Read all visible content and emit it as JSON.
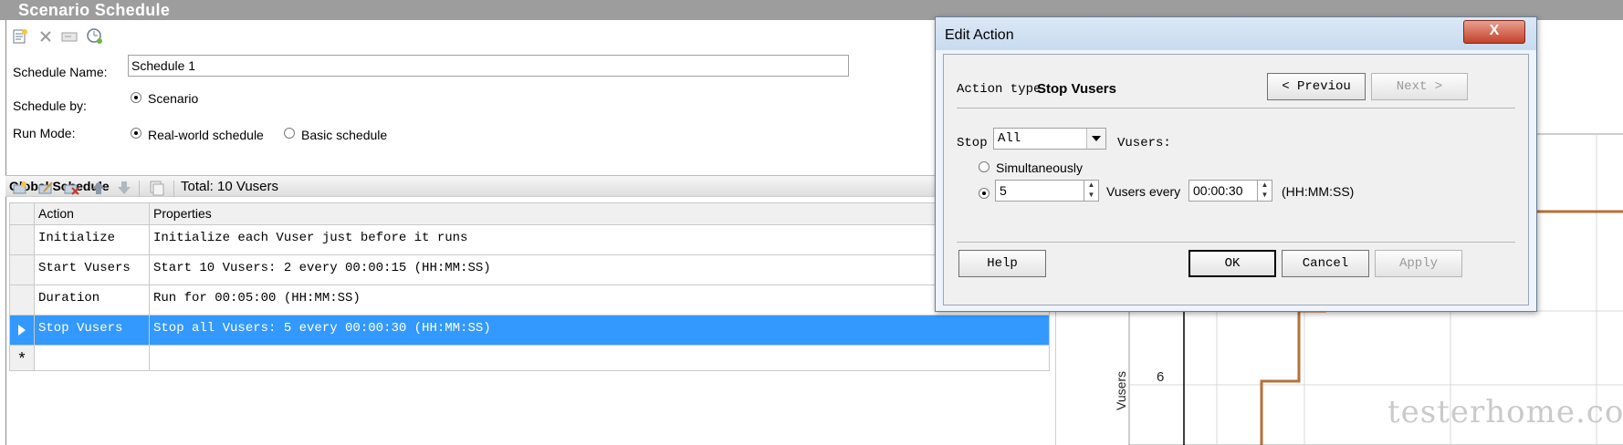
{
  "window": {
    "title": "Scenario Schedule"
  },
  "schedule": {
    "name_label": "Schedule Name:",
    "name_value": "Schedule 1",
    "schedule_by_label": "Schedule by:",
    "schedule_by_option": "Scenario",
    "run_mode_label": "Run Mode:",
    "run_mode_options": [
      "Real-world schedule",
      "Basic schedule"
    ],
    "run_mode_selected": "Real-world schedule"
  },
  "global_schedule": {
    "title": "Global Schedule",
    "total": "Total: 10 Vusers",
    "columns": [
      "Action",
      "Properties"
    ],
    "rows": [
      {
        "action": "Initialize",
        "properties": "Initialize each Vuser just before it runs"
      },
      {
        "action": "Start  Vusers",
        "properties": "Start 10 Vusers: 2 every 00:00:15 (HH:MM:SS)"
      },
      {
        "action": "Duration",
        "properties": "Run for 00:05:00 (HH:MM:SS)"
      },
      {
        "action": "Stop Vusers",
        "properties": "Stop all Vusers: 5 every 00:00:30 (HH:MM:SS)"
      }
    ],
    "selected_row": 3,
    "new_row_marker": "*"
  },
  "chart": {
    "y_label": "Vusers",
    "y_tick": "6",
    "line_color": "#b5703a"
  },
  "dialog": {
    "title": "Edit Action",
    "close": "X",
    "action_type_label": "Action type",
    "action_type_value": "Stop Vusers",
    "previous": "< Previou",
    "next": "Next >",
    "stop_label": "Stop",
    "stop_select": "All",
    "vusers_label": "Vusers:",
    "simultaneously": "Simultaneously",
    "count_value": "5",
    "vusers_every": "Vusers every",
    "interval_value": "00:00:30",
    "time_unit": "(HH:MM:SS)",
    "buttons": {
      "help": "Help",
      "ok": "OK",
      "cancel": "Cancel",
      "apply": "Apply"
    }
  },
  "watermark": "testerhome.com"
}
